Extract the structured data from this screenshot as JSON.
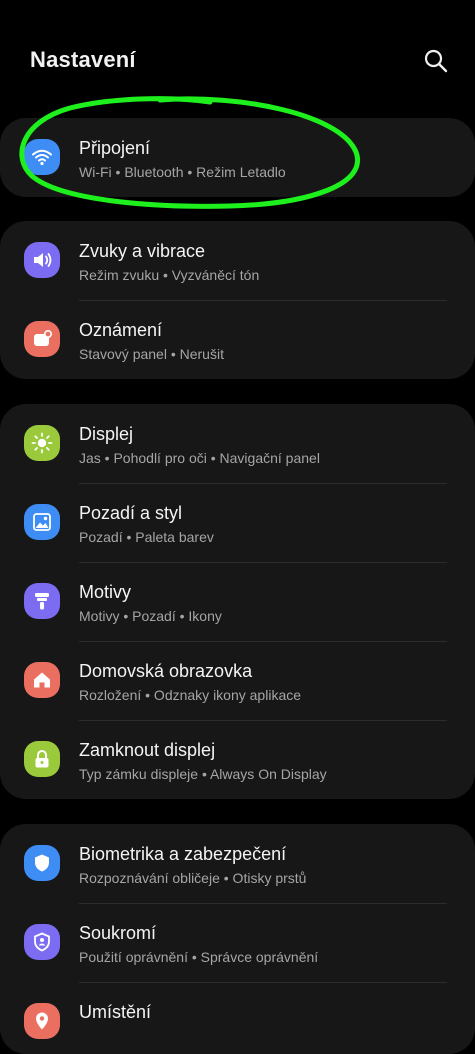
{
  "header": {
    "title": "Nastavení"
  },
  "colors": {
    "background": "#000000",
    "card": "#171717",
    "highlight": "#1ef01e",
    "icon_wifi": "#3e8df5",
    "icon_sound": "#7b6cf2",
    "icon_notifications": "#ea6f61",
    "icon_display": "#9bc93c",
    "icon_wallpaper": "#3e8df5",
    "icon_themes": "#7b6cf2",
    "icon_home": "#ea6f61",
    "icon_lock": "#9bc93c",
    "icon_biometrics": "#3e8df5",
    "icon_privacy": "#7b6cf2",
    "icon_location": "#ea6f61"
  },
  "groups": [
    {
      "items": [
        {
          "label": "Připojení",
          "sub": "Wi-Fi • Bluetooth • Režim Letadlo",
          "icon": "wifi-icon"
        }
      ]
    },
    {
      "items": [
        {
          "label": "Zvuky a vibrace",
          "sub": "Režim zvuku • Vyzváněcí tón",
          "icon": "speaker-icon"
        },
        {
          "label": "Oznámení",
          "sub": "Stavový panel • Nerušit",
          "icon": "notification-icon"
        }
      ]
    },
    {
      "items": [
        {
          "label": "Displej",
          "sub": "Jas • Pohodlí pro oči • Navigační panel",
          "icon": "sun-icon"
        },
        {
          "label": "Pozadí a styl",
          "sub": "Pozadí • Paleta barev",
          "icon": "picture-icon"
        },
        {
          "label": "Motivy",
          "sub": "Motivy • Pozadí • Ikony",
          "icon": "brush-icon"
        },
        {
          "label": "Domovská obrazovka",
          "sub": "Rozložení • Odznaky ikony aplikace",
          "icon": "home-icon"
        },
        {
          "label": "Zamknout displej",
          "sub": "Typ zámku displeje • Always On Display",
          "icon": "lock-icon"
        }
      ]
    },
    {
      "items": [
        {
          "label": "Biometrika a zabezpečení",
          "sub": "Rozpoznávání obličeje • Otisky prstů",
          "icon": "shield-icon"
        },
        {
          "label": "Soukromí",
          "sub": "Použití oprávnění • Správce oprávnění",
          "icon": "privacy-shield-icon"
        },
        {
          "label": "Umístění",
          "sub": "",
          "icon": "location-pin-icon"
        }
      ]
    }
  ]
}
